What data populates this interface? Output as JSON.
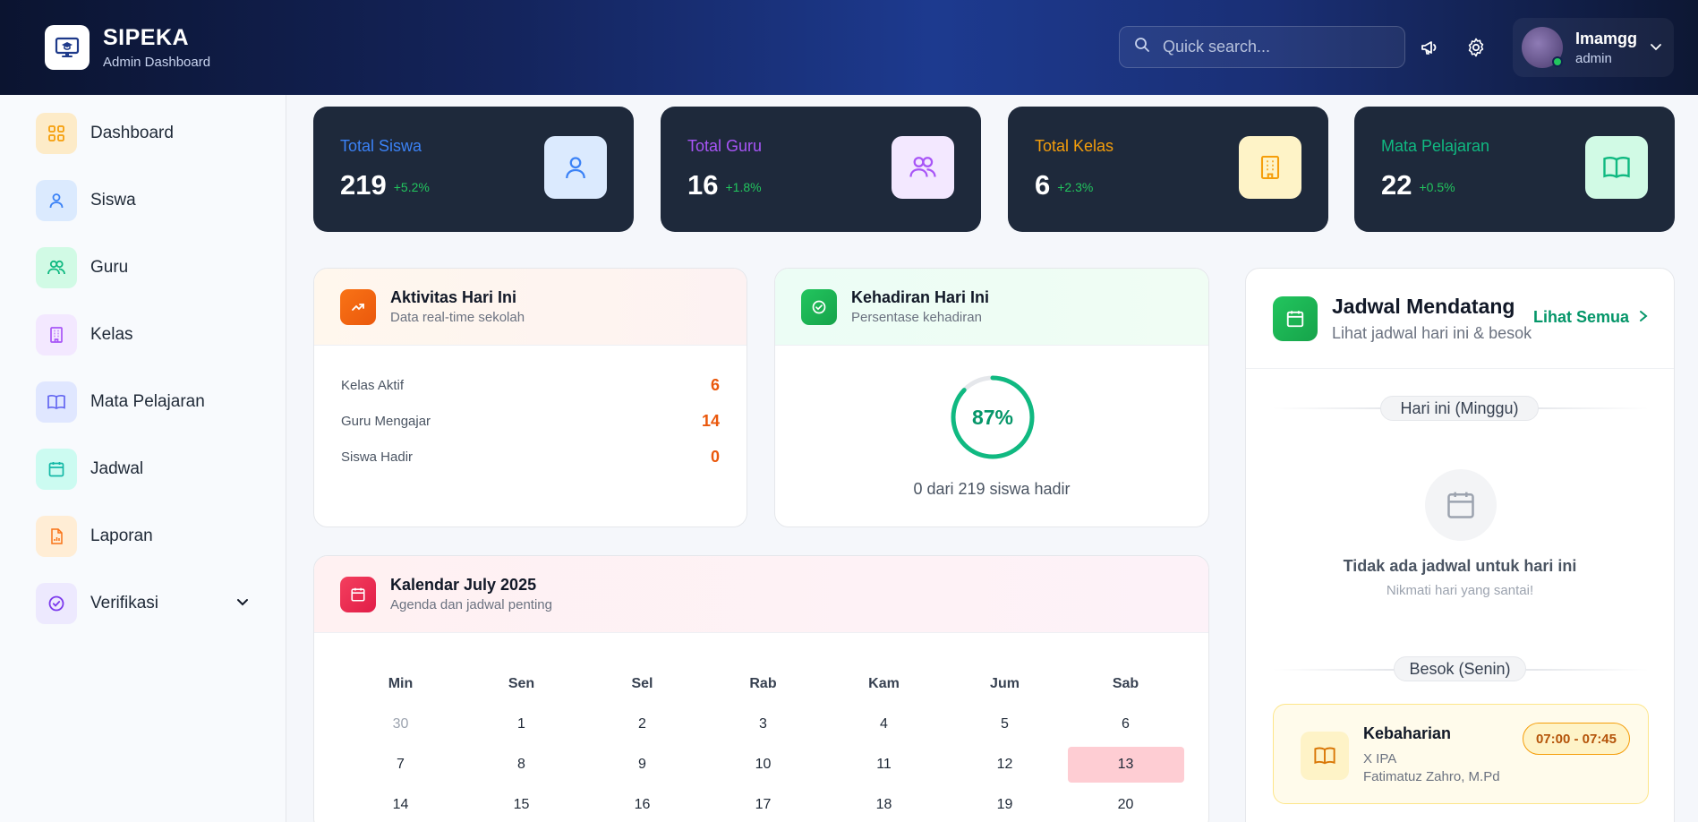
{
  "app": {
    "title": "SIPEKA",
    "subtitle": "Admin Dashboard"
  },
  "search": {
    "placeholder": "Quick search..."
  },
  "user": {
    "name": "Imamgg",
    "role": "admin"
  },
  "sidebar": {
    "items": [
      {
        "label": "Dashboard",
        "icon": "grid-icon"
      },
      {
        "label": "Siswa",
        "icon": "user-icon"
      },
      {
        "label": "Guru",
        "icon": "users-icon"
      },
      {
        "label": "Kelas",
        "icon": "building-icon"
      },
      {
        "label": "Mata Pelajaran",
        "icon": "book-icon"
      },
      {
        "label": "Jadwal",
        "icon": "calendar-icon"
      },
      {
        "label": "Laporan",
        "icon": "report-icon"
      },
      {
        "label": "Verifikasi",
        "icon": "check-circle-icon"
      }
    ]
  },
  "stats": [
    {
      "title": "Total Siswa",
      "value": "219",
      "change": "+5.2%",
      "color": "#3b82f6"
    },
    {
      "title": "Total Guru",
      "value": "16",
      "change": "+1.8%",
      "color": "#a855f7"
    },
    {
      "title": "Total Kelas",
      "value": "6",
      "change": "+2.3%",
      "color": "#f59e0b"
    },
    {
      "title": "Mata Pelajaran",
      "value": "22",
      "change": "+0.5%",
      "color": "#10b981"
    }
  ],
  "activity": {
    "title": "Aktivitas Hari Ini",
    "subtitle": "Data real-time sekolah",
    "rows": [
      {
        "label": "Kelas Aktif",
        "value": "6"
      },
      {
        "label": "Guru Mengajar",
        "value": "14"
      },
      {
        "label": "Siswa Hadir",
        "value": "0"
      }
    ]
  },
  "attendance": {
    "title": "Kehadiran Hari Ini",
    "subtitle": "Persentase kehadiran",
    "percent_label": "87%",
    "percent": 87,
    "caption": "0 dari 219 siswa hadir"
  },
  "calendar": {
    "title": "Kalendar July 2025",
    "subtitle": "Agenda dan jadwal penting",
    "days": [
      "Min",
      "Sen",
      "Sel",
      "Rab",
      "Kam",
      "Jum",
      "Sab"
    ],
    "weeks": [
      [
        "30",
        "1",
        "2",
        "3",
        "4",
        "5",
        "6"
      ],
      [
        "7",
        "8",
        "9",
        "10",
        "11",
        "12",
        "13"
      ],
      [
        "14",
        "15",
        "16",
        "17",
        "18",
        "19",
        "20"
      ]
    ],
    "today": "13"
  },
  "schedule": {
    "title": "Jadwal Mendatang",
    "subtitle": "Lihat jadwal hari ini & besok",
    "link": "Lihat Semua",
    "today_label": "Hari ini (Minggu)",
    "empty_title": "Tidak ada jadwal untuk hari ini",
    "empty_sub": "Nikmati hari yang santai!",
    "tomorrow_label": "Besok (Senin)",
    "item": {
      "subject": "Kebaharian",
      "class": "X IPA",
      "teacher": "Fatimatuz Zahro, M.Pd",
      "time": "07:00 - 07:45"
    }
  }
}
